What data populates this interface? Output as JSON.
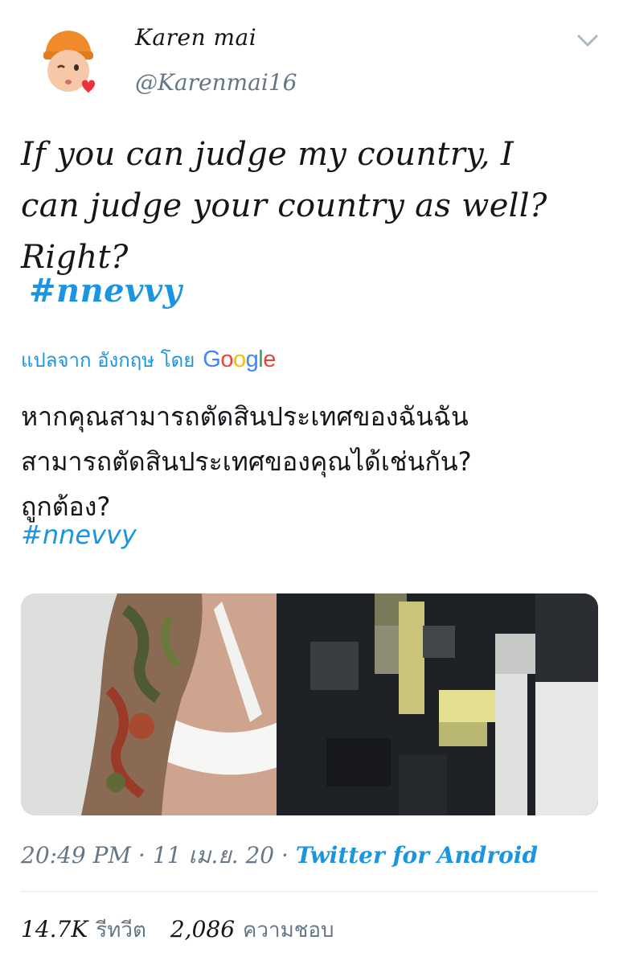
{
  "user": {
    "display_name": "Karen mai",
    "handle": "@Karenmai16"
  },
  "tweet": {
    "lines": [
      "If you can judge my country, I",
      "can judge your country as well?",
      "Right?"
    ],
    "hashtag": "#nnevvy"
  },
  "translation": {
    "prefix": "แปลจาก อังกฤษ โดย",
    "provider_letters": [
      "G",
      "o",
      "o",
      "g",
      "l",
      "e"
    ],
    "provider_colors": [
      "#4285f4",
      "#ea4335",
      "#fbbc05",
      "#4285f4",
      "#34a853",
      "#ea4335"
    ],
    "lines": [
      "หากคุณสามารถตัดสินประเทศของฉันฉัน",
      "สามารถตัดสินประเทศของคุณได้เช่นกัน?",
      "ถูกต้อง?"
    ],
    "hashtag": "#nnevvy"
  },
  "meta": {
    "time": "20:49 PM",
    "separator": " · ",
    "date": "11 เม.ย. 20",
    "source": "Twitter for Android"
  },
  "stats": {
    "retweets_count": "14.7K",
    "retweets_label": "รีทวีต",
    "likes_count": "2,086",
    "likes_label": "ความชอบ"
  },
  "colors": {
    "link": "#1b95e0",
    "muted": "#657786",
    "text": "#14171a"
  },
  "icons": {
    "menu": "chevron-down-icon",
    "avatar": "memoji-avatar"
  }
}
